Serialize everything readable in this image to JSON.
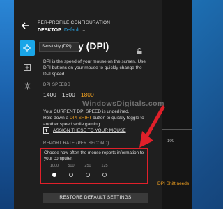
{
  "header": {
    "title": "PER-PROFILE CONFIGURATION",
    "profile_prefix": "DESKTOP:",
    "profile_value": "Default"
  },
  "tooltip": "Sensitivity (DPI)",
  "panel": {
    "title": "y (DPI)",
    "description": "DPI is the speed of your mouse on the screen. Use DPI buttons on your mouse to quickly change the DPI speed."
  },
  "dpi_speeds": {
    "label": "DPI SPEEDS",
    "values": [
      "1400",
      "1600",
      "1800"
    ],
    "current": "1800"
  },
  "note": {
    "line1": "Your CURRENT DPI SPEED is underlined.",
    "line2_pre": "Hold down a ",
    "line2_hl": "DPI SHIFT",
    "line2_post": " button to quickly toggle to another speed while gaming."
  },
  "assign_label": "ASSIGN THESE TO YOUR MOUSE",
  "report_rate": {
    "label": "REPORT RATE (PER SECOND)",
    "description": "Choose how often the mouse reports information to your computer.",
    "options": [
      "1000",
      "500",
      "250",
      "125"
    ],
    "selected_index": 0
  },
  "restore_button": "RESTORE DEFAULT SETTINGS",
  "right_pane": {
    "slider_value": "100",
    "shift_note": "DPI Shift needs"
  },
  "watermark": "WindowsDigitals.com",
  "colors": {
    "accent_blue": "#1aa6e8",
    "highlight_orange": "#f0a020",
    "annotation_red": "#e0202a"
  }
}
